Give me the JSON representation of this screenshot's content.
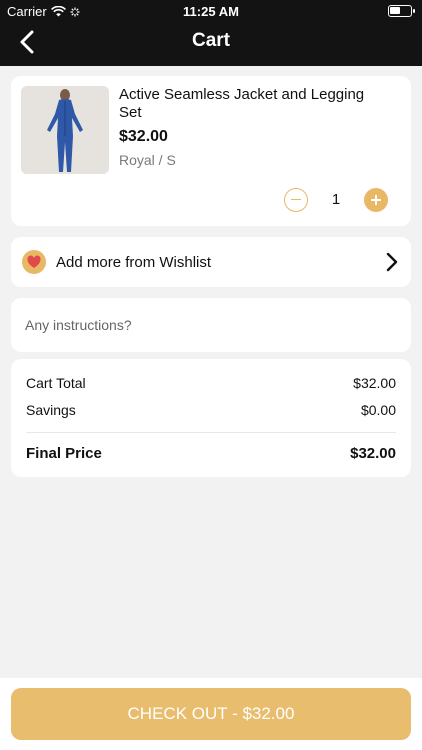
{
  "status_bar": {
    "carrier": "Carrier",
    "time": "11:25 AM"
  },
  "nav": {
    "title": "Cart",
    "back_icon": "chevron-left-icon"
  },
  "cart_item": {
    "name": "Active Seamless Jacket and Legging Set",
    "price": "$32.00",
    "variant": "Royal / S",
    "quantity": "1"
  },
  "wishlist": {
    "label": "Add more from Wishlist",
    "icon": "heart-icon"
  },
  "instructions": {
    "placeholder": "Any instructions?",
    "value": ""
  },
  "summary": {
    "cart_total_label": "Cart Total",
    "cart_total_value": "$32.00",
    "savings_label": "Savings",
    "savings_value": "$0.00",
    "final_label": "Final Price",
    "final_value": "$32.00"
  },
  "checkout": {
    "label": "CHECK OUT - $32.00"
  },
  "colors": {
    "accent": "#e8b864",
    "nav_bg": "#131313",
    "page_bg": "#f2f2f2"
  }
}
